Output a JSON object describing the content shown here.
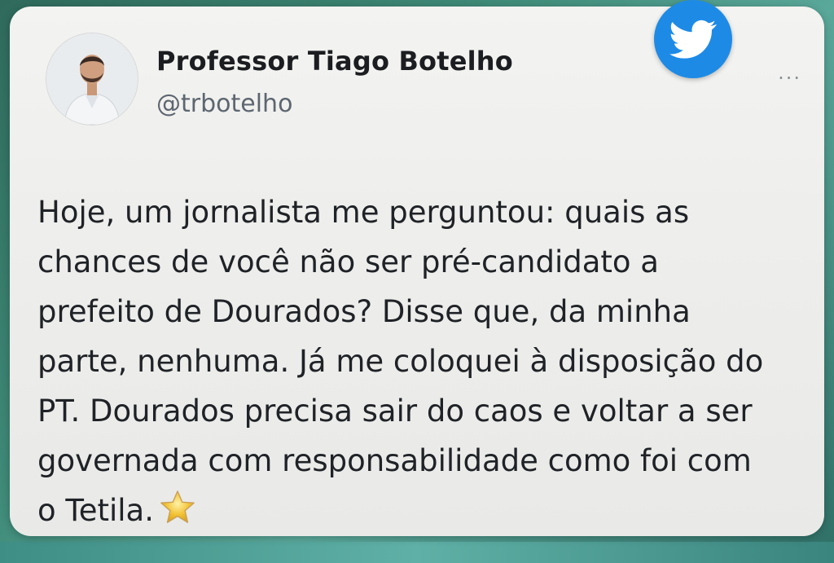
{
  "tweet": {
    "author_name": "Professor Tiago Botelho",
    "author_handle": "@trbotelho",
    "text_lines": [
      "Hoje, um jornalista me perguntou: quais as",
      "chances de você não ser pré-candidato a",
      "prefeito de Dourados? Disse que, da minha",
      "parte, nenhuma. Já me coloquei à disposição do",
      "PT. Dourados precisa sair do caos e voltar a ser",
      "governada com responsabilidade como foi com",
      "o Tetila."
    ],
    "more_label": "···"
  },
  "icons": {
    "brand": "twitter-bird-icon",
    "emoji": "star-icon",
    "more": "more-options-icon"
  },
  "colors": {
    "twitter_blue": "#1d8be6",
    "card_background": "#eeeeec",
    "text": "#1f2226",
    "handle": "#5d6670",
    "star": "#f2c233"
  }
}
